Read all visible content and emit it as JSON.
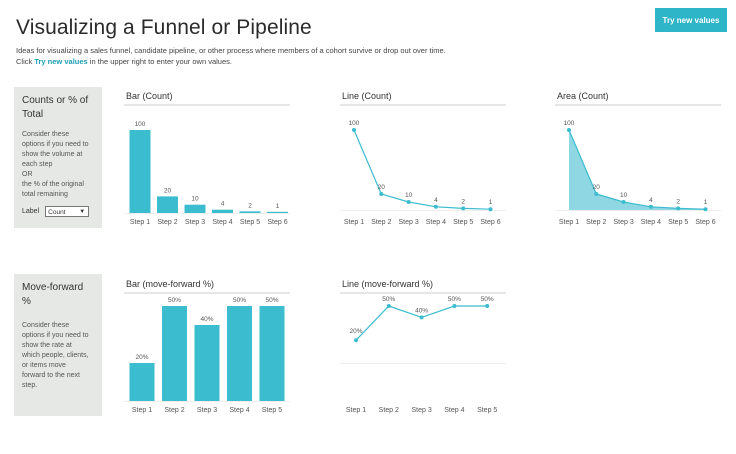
{
  "header": {
    "title": "Visualizing a Funnel or Pipeline",
    "subtitle_line1": "Ideas for visualizing a sales funnel, candidate pipeline, or other process where members of a cohort survive or drop out over time.",
    "subtitle_line2_prefix": "Click ",
    "subtitle_line2_link": "Try new values",
    "subtitle_line2_suffix": " in the upper right to enter your own values.",
    "try_button": "Try new values"
  },
  "sections": {
    "counts": {
      "heading_l1": "Counts or % of",
      "heading_l2": "Total",
      "body": [
        "Consider these",
        "options if you need to",
        "show the volume at",
        "each step",
        "OR",
        "the % of the original",
        "total remaining"
      ],
      "label_text": "Label",
      "label_select": "Count"
    },
    "forward": {
      "heading": "Move-forward %",
      "body": [
        "Consider these",
        "options if you need to",
        "show the rate at",
        "which people, clients,",
        "or items move",
        "forward to the next",
        "step."
      ]
    }
  },
  "colors": {
    "accent": "#3cbccf",
    "area_fill": "#8fd7e2",
    "panel": "#e6e8e6",
    "button": "#2eb5c8"
  },
  "chart_data": [
    {
      "type": "bar",
      "title": "Bar (Count)",
      "categories": [
        "Step 1",
        "Step 2",
        "Step 3",
        "Step 4",
        "Step 5",
        "Step 6"
      ],
      "values": [
        100,
        20,
        10,
        4,
        2,
        1
      ],
      "labels": [
        "100",
        "20",
        "10",
        "4",
        "2",
        "1"
      ],
      "ylim": [
        0,
        100
      ]
    },
    {
      "type": "line",
      "title": "Line (Count)",
      "categories": [
        "Step 1",
        "Step 2",
        "Step 3",
        "Step 4",
        "Step 5",
        "Step 6"
      ],
      "values": [
        100,
        20,
        10,
        4,
        2,
        1
      ],
      "labels": [
        "100",
        "20",
        "10",
        "4",
        "2",
        "1"
      ],
      "ylim": [
        0,
        100
      ]
    },
    {
      "type": "area",
      "title": "Area (Count)",
      "categories": [
        "Step 1",
        "Step 2",
        "Step 3",
        "Step 4",
        "Step 5",
        "Step 6"
      ],
      "values": [
        100,
        20,
        10,
        4,
        2,
        1
      ],
      "labels": [
        "100",
        "20",
        "10",
        "4",
        "2",
        "1"
      ],
      "ylim": [
        0,
        100
      ]
    },
    {
      "type": "bar",
      "title": "Bar (move-forward %)",
      "categories": [
        "Step 1",
        "Step 2",
        "Step 3",
        "Step 4",
        "Step 5"
      ],
      "values": [
        20,
        50,
        40,
        50,
        50
      ],
      "labels": [
        "20%",
        "50%",
        "40%",
        "50%",
        "50%"
      ],
      "ylim": [
        0,
        50
      ]
    },
    {
      "type": "line",
      "title": "Line (move-forward %)",
      "categories": [
        "Step 1",
        "Step 2",
        "Step 3",
        "Step 4",
        "Step 5"
      ],
      "values": [
        20,
        50,
        40,
        50,
        50
      ],
      "labels": [
        "20%",
        "50%",
        "40%",
        "50%",
        "50%"
      ],
      "ylim": [
        0,
        50
      ]
    }
  ]
}
